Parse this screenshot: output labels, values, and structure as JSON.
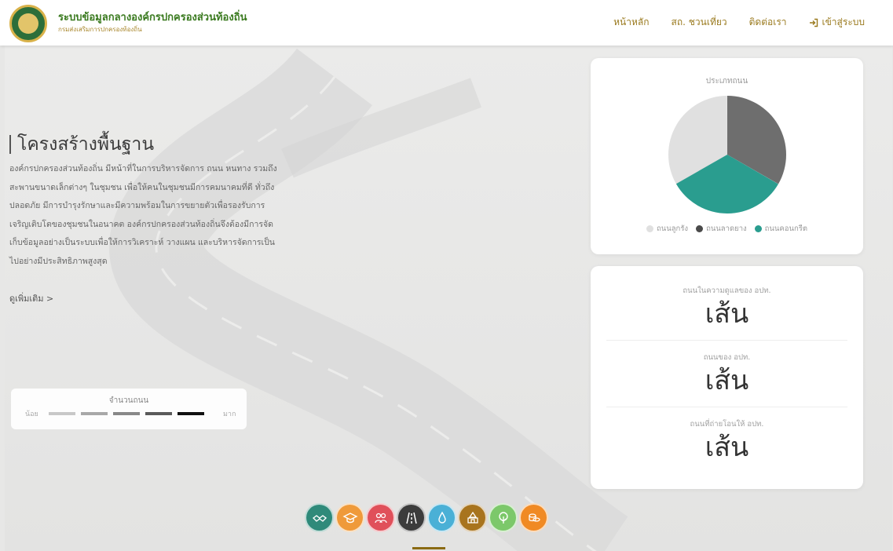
{
  "header": {
    "title": "ระบบข้อมูลกลางองค์กรปกครองส่วนท้องถิ่น",
    "subtitle": "กรมส่งเสริมการปกครองท้องถิ่น",
    "nav": [
      {
        "label": "หน้าหลัก",
        "icon": ""
      },
      {
        "label": "สถ. ชวนเที่ยว",
        "icon": ""
      },
      {
        "label": "ติดต่อเรา",
        "icon": ""
      },
      {
        "label": "เข้าสู่ระบบ",
        "icon": "login-icon"
      }
    ]
  },
  "hero": {
    "title": "โครงสร้างพื้นฐาน",
    "description": "องค์กรปกครองส่วนท้องถิ่น มีหน้าที่ในการบริหารจัดการ ถนน หนทาง รวมถึงสะพานขนาดเล็กต่างๆ ในชุมชน เพื่อให้คนในชุมชนมีการคมนาคมที่ดี ทั่วถึง ปลอดภัย มีการบำรุงรักษาและมีความพร้อมในการขยายตัวเพื่อรองรับการเจริญเติบโตของชุมชนในอนาคต องค์กรปกครองส่วนท้องถิ่นจึงต้องมีการจัดเก็บข้อมูลอย่างเป็นระบบเพื่อให้การวิเคราะห์ วางแผน และบริหารจัดการเป็นไปอย่างมีประสิทธิภาพสูงสุด",
    "more_link": "ดูเพิ่มเติม >"
  },
  "legend": {
    "title": "จำนวนถนน",
    "low": "น้อย",
    "high": "มาก",
    "colors": [
      "#c8c8c8",
      "#a8a8a8",
      "#888888",
      "#5a5a5a",
      "#111111"
    ]
  },
  "pie": {
    "title": "ประเภทถนน",
    "items": [
      {
        "label": "ถนนลูกรัง",
        "color": "#e0e0e0"
      },
      {
        "label": "ถนนลาดยาง",
        "color": "#6e6e6e"
      },
      {
        "label": "ถนนคอนกรีต",
        "color": "#2a9d8f"
      }
    ]
  },
  "chart_data": {
    "type": "pie",
    "title": "ประเภทถนน",
    "categories": [
      "ถนนลูกรัง",
      "ถนนลาดยาง",
      "ถนนคอนกรีต"
    ],
    "values": [
      33.3,
      33.3,
      33.4
    ],
    "colors": [
      "#e0e0e0",
      "#6e6e6e",
      "#2a9d8f"
    ],
    "legend": "bottom"
  },
  "stats": [
    {
      "label": "ถนนในความดูแลของ อปท.",
      "value": "เส้น"
    },
    {
      "label": "ถนนของ อปท.",
      "value": "เส้น"
    },
    {
      "label": "ถนนที่ถ่ายโอนให้ อปท.",
      "value": "เส้น"
    }
  ],
  "categories": [
    {
      "name": "handshake-icon",
      "color": "#2f8a7a"
    },
    {
      "name": "graduation-cap-icon",
      "color": "#ef9a3a"
    },
    {
      "name": "people-icon",
      "color": "#e0505a"
    },
    {
      "name": "road-icon",
      "color": "#3c3c3c"
    },
    {
      "name": "water-drop-icon",
      "color": "#4ab0d6"
    },
    {
      "name": "temple-icon",
      "color": "#a8741e"
    },
    {
      "name": "tree-icon",
      "color": "#7cc86a"
    },
    {
      "name": "coins-icon",
      "color": "#f08a24"
    }
  ]
}
